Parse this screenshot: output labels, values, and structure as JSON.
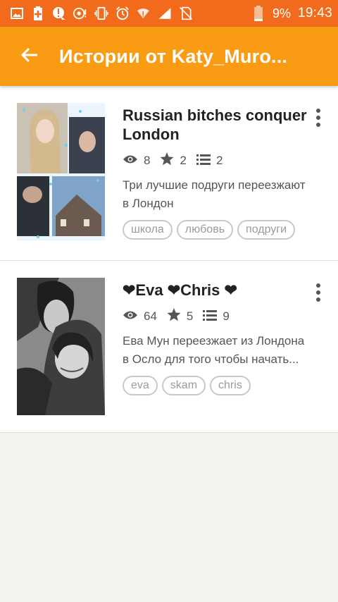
{
  "status_bar": {
    "battery_percent": "9%",
    "time": "19:43",
    "icons": [
      "image-icon",
      "battery-saver-icon",
      "alert-icon",
      "sync-icon",
      "vibrate-icon",
      "alarm-icon",
      "wifi-alert-icon",
      "signal-icon",
      "no-sim-icon",
      "battery-icon"
    ]
  },
  "app_bar": {
    "title": "Истории от Katy_Muro..."
  },
  "stories": [
    {
      "title": "Russian bitches conquer London",
      "views": "8",
      "votes": "2",
      "parts": "2",
      "description_line1": "Три лучшие подруги переезжают",
      "description_line2": "в Лондон",
      "tags": [
        "школа",
        "любовь",
        "подруги"
      ]
    },
    {
      "title": "❤Eva ❤Chris ❤",
      "views": "64",
      "votes": "5",
      "parts": "9",
      "description_line1": "Ева Мун переезжает из Лондона",
      "description_line2": "в Осло  для того чтобы начать...",
      "tags": [
        "eva",
        "skam",
        "chris"
      ]
    }
  ],
  "colors": {
    "status_bar": "#f26b1d",
    "app_bar": "#fa9b14"
  }
}
